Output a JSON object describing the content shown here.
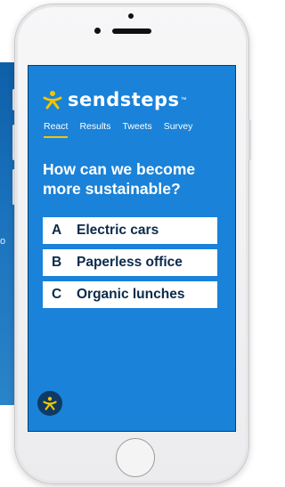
{
  "background": {
    "fragment_text": "o"
  },
  "app": {
    "brand": "sendsteps",
    "tm": "™",
    "tabs": [
      {
        "label": "React",
        "active": true
      },
      {
        "label": "Results",
        "active": false
      },
      {
        "label": "Tweets",
        "active": false
      },
      {
        "label": "Survey",
        "active": false
      }
    ],
    "question": "How can we become more sustainable?",
    "options": [
      {
        "letter": "A",
        "label": "Electric cars"
      },
      {
        "letter": "B",
        "label": "Paperless office"
      },
      {
        "letter": "C",
        "label": "Organic lunches"
      }
    ],
    "colors": {
      "screen_bg": "#1a82d8",
      "accent": "#f2c500",
      "option_text": "#0b2b4a",
      "fab_bg": "#0e3a63"
    }
  }
}
